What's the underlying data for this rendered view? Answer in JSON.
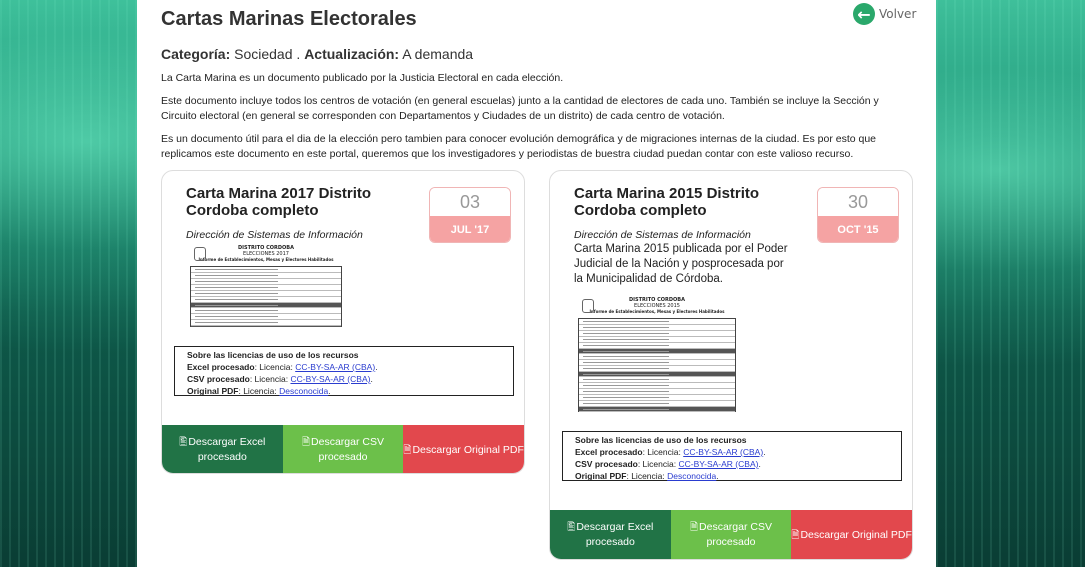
{
  "page": {
    "title": "Cartas Marinas Electorales",
    "back_label": "Volver",
    "back_icon": "arrow-left-icon",
    "category_label": "Categoría:",
    "category_value": "Sociedad",
    "separator": ".",
    "update_label": "Actualización:",
    "update_value": "A demanda",
    "paragraphs": [
      "La Carta Marina es un documento publicado por la Justicia Electoral en cada elección.",
      "Este documento incluye todos los centros de votación (en general escuelas) junto a la cantidad de electores de cada uno. También se incluye la Sección y Circuito electoral (en general se corresponden con Departamentos y Ciudades de un distrito) de cada centro de votación.",
      "Es un documento útil para el dia de la elección pero tambien para conocer evolución demográfica y de migraciones internas de la ciudad. Es por esto que replicamos este documento en este portal, queremos que los investigadores y periodistas de buestra ciudad puedan contar con este valioso recurso."
    ]
  },
  "cards": [
    {
      "title": "Carta Marina 2017 Distrito Cordoba completo",
      "day": "03",
      "month": "JUL '17",
      "org": "Dirección de Sistemas de Información",
      "description": "",
      "doc_header": [
        "DISTRITO CORDOBA",
        "ELECCIONES 2017",
        "Informe de Establecimientos, Mesas y Electores Habilitados"
      ],
      "license": {
        "title": "Sobre las licencias de uso de los recursos",
        "excel_label": "Excel procesado",
        "excel_text": ": Licencia: ",
        "excel_link": "CC-BY-SA-AR (CBA)",
        "csv_label": "CSV procesado",
        "csv_text": ": Licencia: ",
        "csv_link": "CC-BY-SA-AR (CBA)",
        "pdf_label": "Original PDF",
        "pdf_text": ": Licencia: ",
        "pdf_link": "Desconocida",
        "end": "."
      },
      "buttons": {
        "excel": "Descargar Excel procesado",
        "csv": "Descargar CSV procesado",
        "pdf": "Descargar Original PDF"
      }
    },
    {
      "title": "Carta Marina 2015 Distrito Cordoba completo",
      "day": "30",
      "month": "OCT '15",
      "org": "Dirección de Sistemas de Información",
      "description": "Carta Marina 2015 publicada por el Poder Judicial de la Nación y posprocesada por la Municipalidad de Córdoba.",
      "doc_header": [
        "DISTRITO CORDOBA",
        "ELECCIONES 2015",
        "Informe de Establecimientos, Mesas y Electores Habilitados"
      ],
      "license": {
        "title": "Sobre las licencias de uso de los recursos",
        "excel_label": "Excel procesado",
        "excel_text": ": Licencia: ",
        "excel_link": "CC-BY-SA-AR (CBA)",
        "csv_label": "CSV procesado",
        "csv_text": ": Licencia: ",
        "csv_link": "CC-BY-SA-AR (CBA)",
        "pdf_label": "Original PDF",
        "pdf_text": ": Licencia: ",
        "pdf_link": "Desconocida",
        "end": "."
      },
      "buttons": {
        "excel": "Descargar Excel procesado",
        "csv": "Descargar CSV procesado",
        "pdf": "Descargar Original PDF"
      }
    }
  ],
  "colors": {
    "excel": "#217346",
    "csv": "#6cc04a",
    "pdf": "#e2484d",
    "back": "#2aa86b",
    "date_band": "#f5a3a3"
  }
}
